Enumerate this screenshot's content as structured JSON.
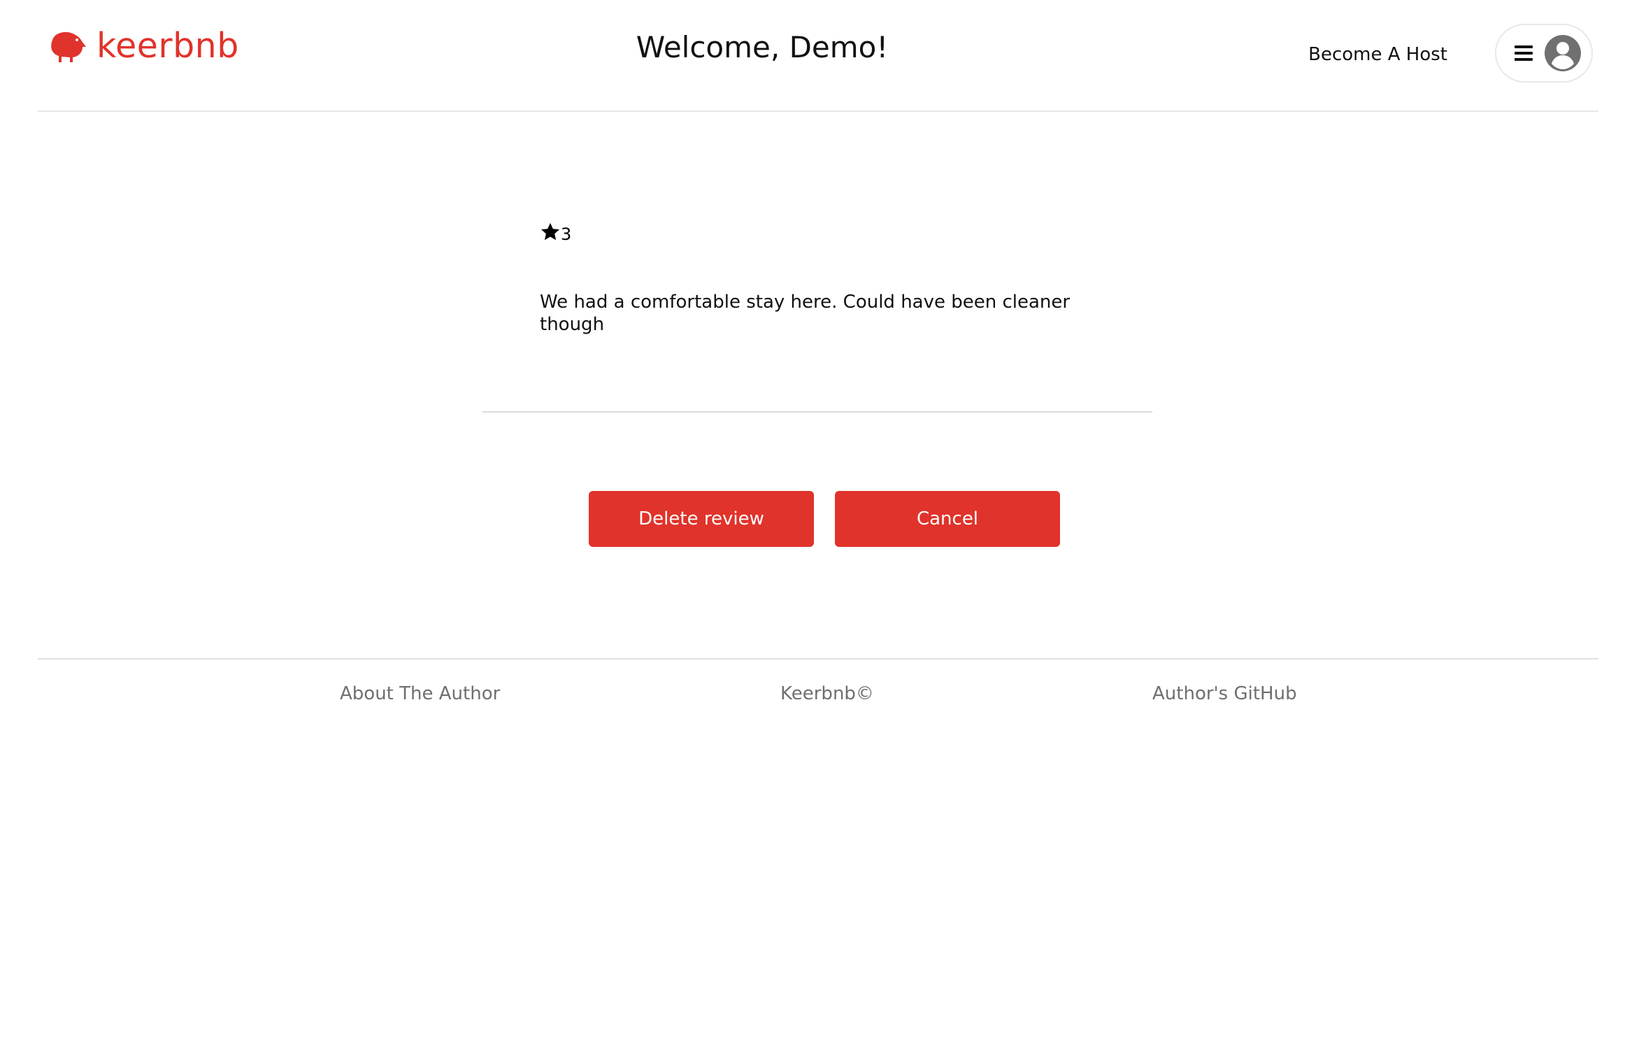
{
  "header": {
    "logo_text": "keerbnb",
    "welcome": "Welcome, Demo!",
    "become_host": "Become A Host",
    "menu_icon": "hamburger-menu-icon",
    "user_icon": "user-avatar-icon"
  },
  "review": {
    "rating": "3",
    "rating_icon": "star-icon",
    "text": "We had a comfortable stay here. Could have been cleaner though"
  },
  "actions": {
    "delete_label": "Delete review",
    "cancel_label": "Cancel"
  },
  "footer": {
    "about": "About The Author",
    "brand": "Keerbnb©",
    "github": "Author's GitHub"
  },
  "colors": {
    "brand": "#e0332b",
    "footer_text": "#6f6f6f",
    "divider": "#e6e6e6"
  }
}
